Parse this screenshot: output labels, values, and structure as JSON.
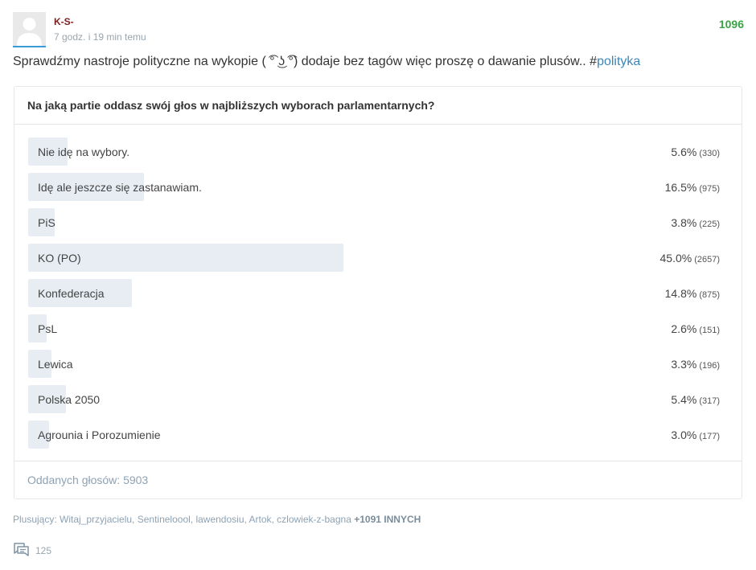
{
  "post": {
    "author": "K-S-",
    "time": "7 godz. i 19 min temu",
    "votes": "1096",
    "text": "Sprawdźmy nastroje polityczne na wykopie ( ͡° ͜ʖ ͡°) dodaje bez tagów więc proszę o dawanie plusów.. #",
    "tag": "polityka"
  },
  "poll": {
    "question": "Na jaką partie oddasz swój głos w najbliższych wyborach parlamentarnych?",
    "options": [
      {
        "label": "Nie idę na wybory.",
        "percent": "5.6%",
        "count": "(330)",
        "fraction": 0.056
      },
      {
        "label": "Idę ale jeszcze się zastanawiam.",
        "percent": "16.5%",
        "count": "(975)",
        "fraction": 0.165
      },
      {
        "label": "PiS",
        "percent": "3.8%",
        "count": "(225)",
        "fraction": 0.038
      },
      {
        "label": "KO (PO)",
        "percent": "45.0%",
        "count": "(2657)",
        "fraction": 0.45
      },
      {
        "label": "Konfederacja",
        "percent": "14.8%",
        "count": "(875)",
        "fraction": 0.148
      },
      {
        "label": "PsL",
        "percent": "2.6%",
        "count": "(151)",
        "fraction": 0.026
      },
      {
        "label": "Lewica",
        "percent": "3.3%",
        "count": "(196)",
        "fraction": 0.033
      },
      {
        "label": "Polska 2050",
        "percent": "5.4%",
        "count": "(317)",
        "fraction": 0.054
      },
      {
        "label": "Agrounia i Porozumienie",
        "percent": "3.0%",
        "count": "(177)",
        "fraction": 0.03
      }
    ],
    "total": "Oddanych głosów: 5903"
  },
  "plusers": {
    "prefix": "Plusujący: ",
    "names": "Witaj_przyjacielu, Sentineloool, lawendosiu, Artok, czlowiek-z-bagna",
    "more": "+1091 INNYCH"
  },
  "comments": {
    "count": "125",
    "icon": "comment-icon"
  },
  "colors": {
    "author": "#7b1e1e",
    "votes": "#3aa447",
    "tag": "#3b86b8",
    "bar": "#e7edf3"
  }
}
